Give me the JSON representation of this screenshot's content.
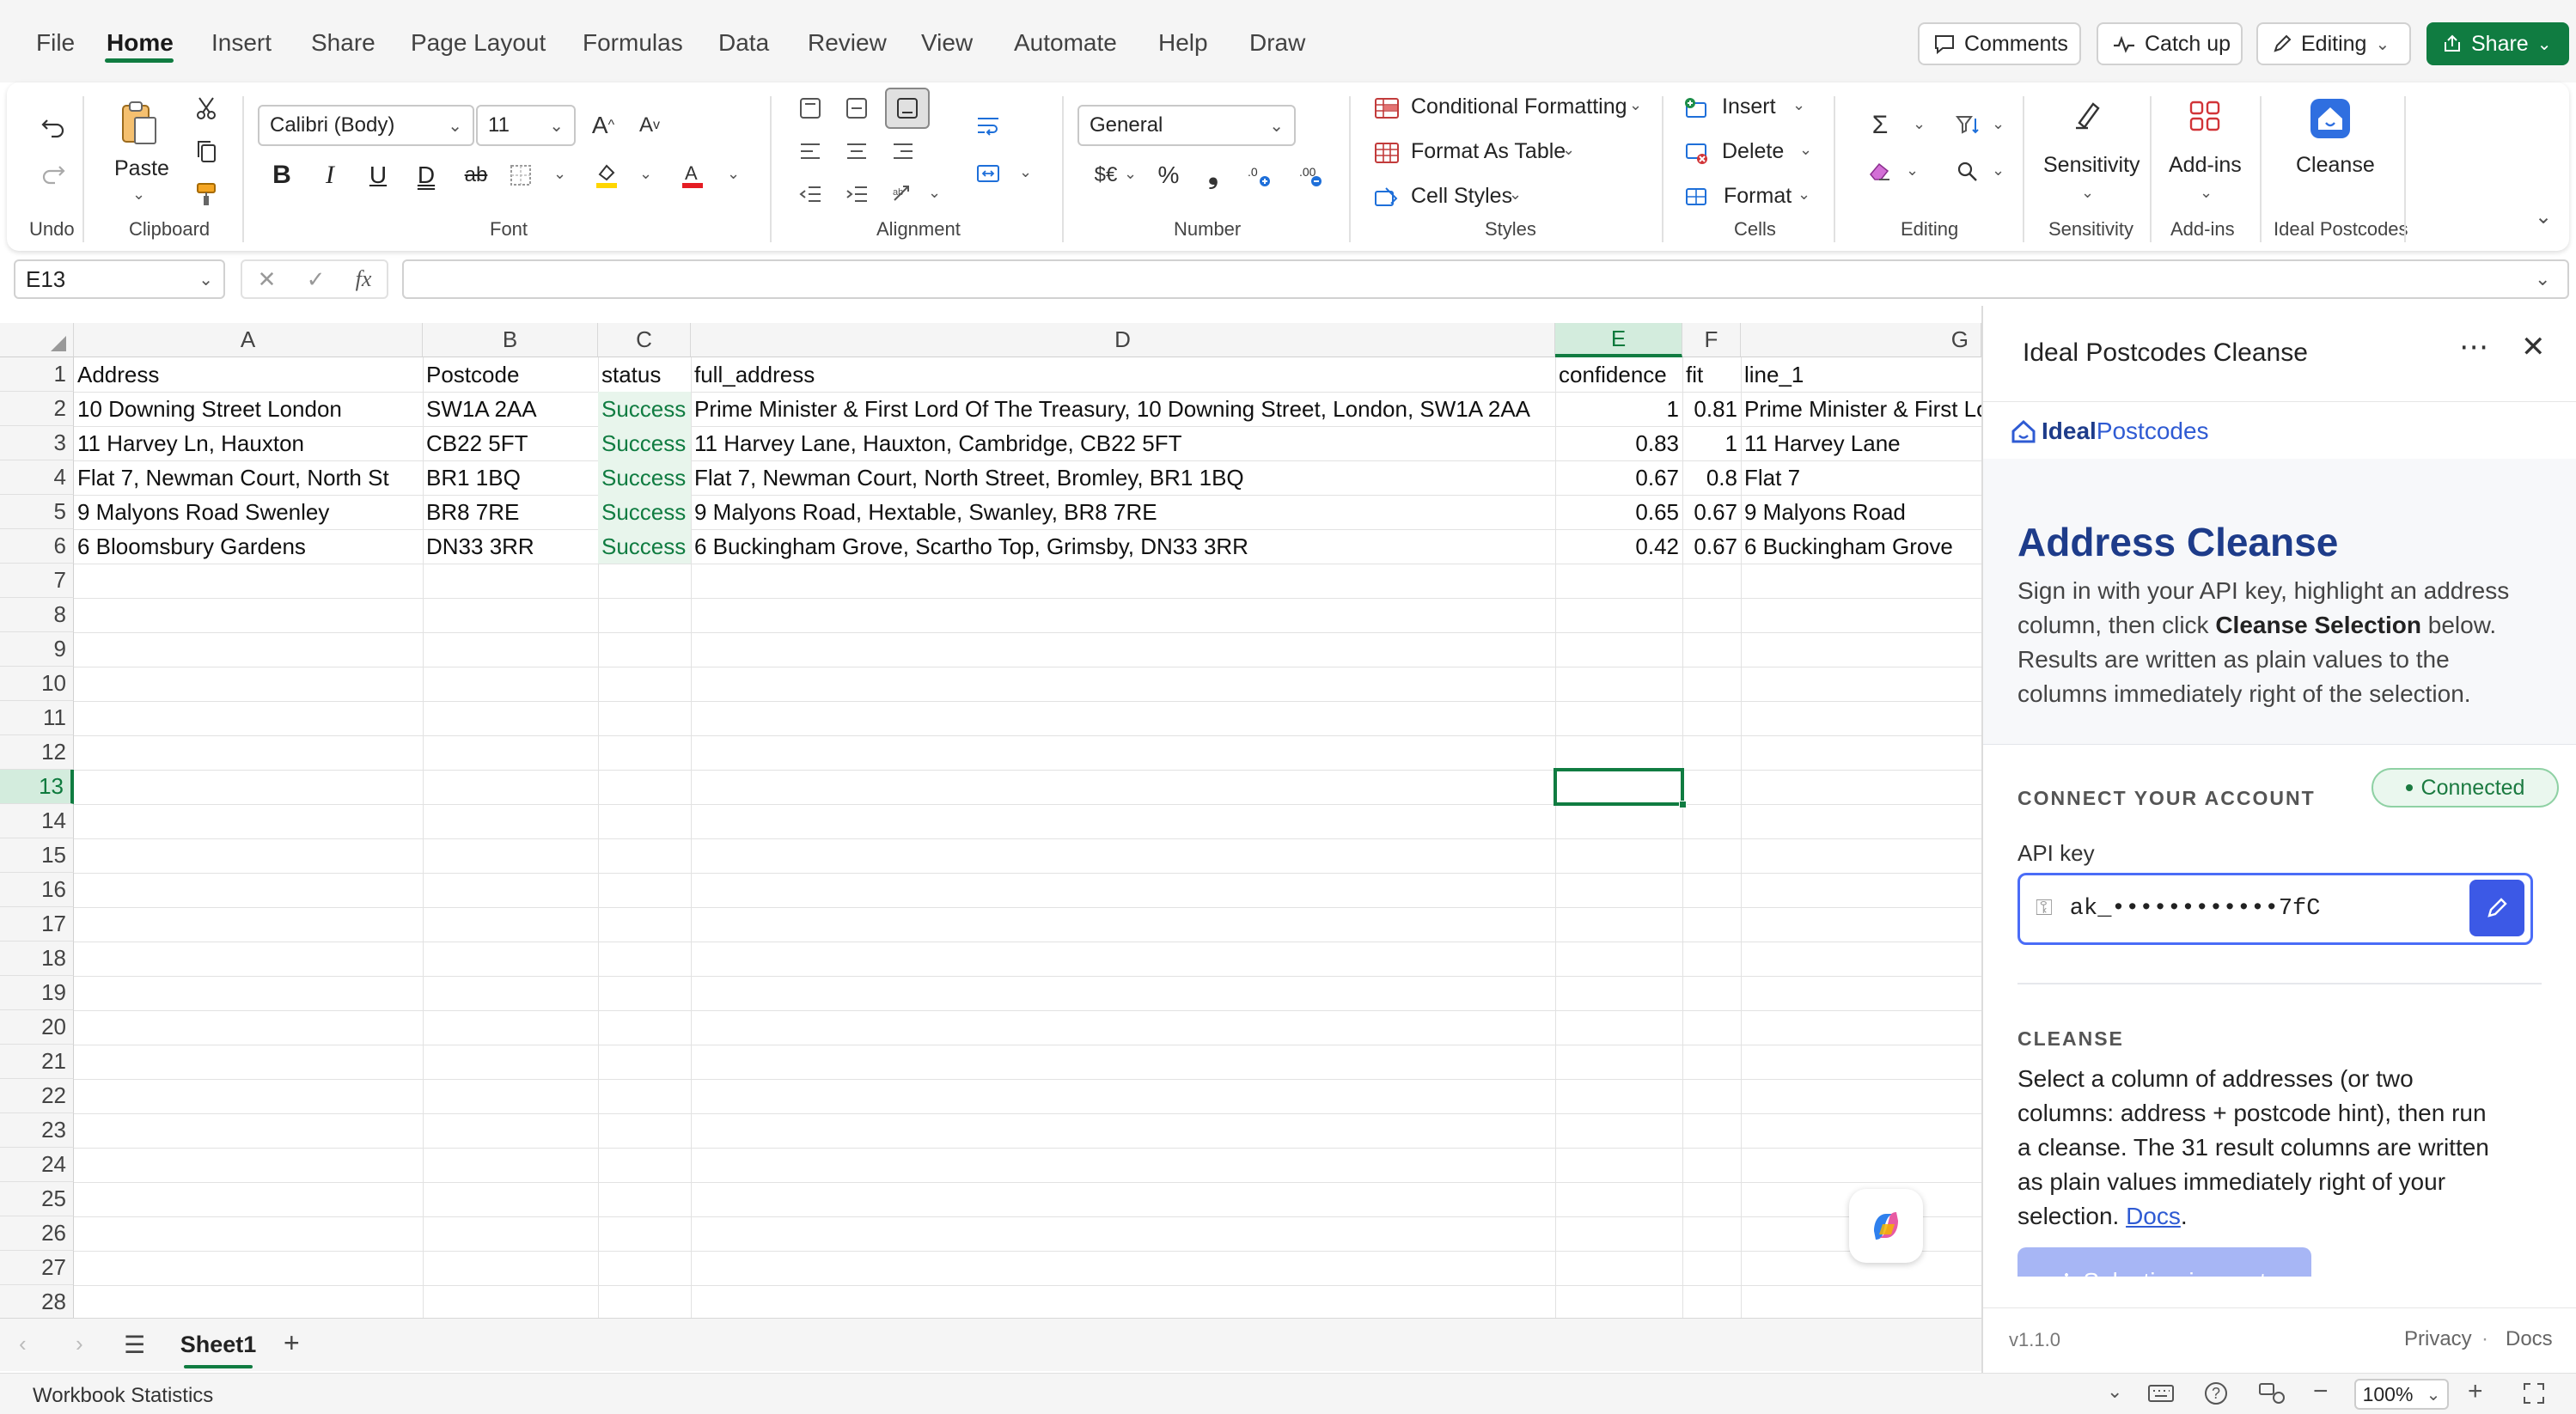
{
  "menu": {
    "items": [
      "File",
      "Home",
      "Insert",
      "Share",
      "Page Layout",
      "Formulas",
      "Data",
      "Review",
      "View",
      "Automate",
      "Help",
      "Draw"
    ],
    "active": "Home",
    "comments_label": "Comments",
    "catchup_label": "Catch up",
    "editing_label": "Editing",
    "share_label": "Share"
  },
  "ribbon": {
    "groups": {
      "undo": "Undo",
      "clipboard": "Clipboard",
      "font": "Font",
      "alignment": "Alignment",
      "number": "Number",
      "styles": "Styles",
      "cells": "Cells",
      "editing": "Editing",
      "sensitivity": "Sensitivity",
      "addins": "Add-ins",
      "ideal": "Ideal Postcodes"
    },
    "paste_label": "Paste",
    "font_name": "Calibri (Body)",
    "font_size": "11",
    "number_format": "General",
    "currency_symbol": "$€",
    "percent_symbol": "%",
    "comma_symbol": "❟",
    "conditional_formatting": "Conditional Formatting",
    "format_as_table": "Format As Table",
    "cell_styles": "Cell Styles",
    "insert": "Insert",
    "delete": "Delete",
    "format": "Format",
    "sensitivity_btn": "Sensitivity",
    "addins_btn": "Add-ins",
    "cleanse_btn": "Cleanse",
    "bold": "B",
    "italic": "I",
    "underline": "U",
    "dunderline": "D",
    "strike": "ab"
  },
  "formula_bar": {
    "name_box": "E13",
    "fx": "fx",
    "value": ""
  },
  "sheet": {
    "columns": [
      "A",
      "B",
      "C",
      "D",
      "E",
      "F",
      "G"
    ],
    "selected_column": "E",
    "row_numbers": [
      "1",
      "2",
      "3",
      "4",
      "5",
      "6",
      "7",
      "8",
      "9",
      "10",
      "11",
      "12",
      "13",
      "14",
      "15",
      "16",
      "17",
      "18",
      "19",
      "20",
      "21",
      "22",
      "23",
      "24",
      "25",
      "26",
      "27",
      "28"
    ],
    "selected_row": "13",
    "headers": [
      "Address",
      "Postcode",
      "status",
      "full_address",
      "confidence",
      "fit",
      "line_1"
    ],
    "rows": [
      [
        "10 Downing Street London",
        "SW1A 2AA",
        "Success",
        "Prime Minister & First Lord Of The Treasury, 10 Downing Street, London, SW1A 2AA",
        "1",
        "0.81",
        "Prime Minister & First Lord Of The Treasury"
      ],
      [
        "11 Harvey Ln, Hauxton",
        "CB22 5FT",
        "Success",
        "11 Harvey Lane, Hauxton, Cambridge, CB22 5FT",
        "0.83",
        "1",
        "11 Harvey Lane"
      ],
      [
        "Flat 7, Newman Court, North St",
        "BR1 1BQ",
        "Success",
        "Flat 7, Newman Court, North Street, Bromley, BR1 1BQ",
        "0.67",
        "0.8",
        "Flat 7"
      ],
      [
        "9 Malyons Road Swenley",
        "BR8 7RE",
        "Success",
        "9 Malyons Road, Hextable, Swanley, BR8 7RE",
        "0.65",
        "0.67",
        "9 Malyons Road"
      ],
      [
        "6 Bloomsbury Gardens",
        "DN33 3RR",
        "Success",
        "6 Buckingham Grove, Scartho Top, Grimsby, DN33 3RR",
        "0.42",
        "0.67",
        "6 Buckingham Grove"
      ]
    ]
  },
  "tabs": {
    "sheet_name": "Sheet1"
  },
  "status": {
    "left": "Workbook Statistics",
    "zoom": "100%"
  },
  "pane": {
    "title": "Ideal Postcodes Cleanse",
    "logo_bold": "Ideal",
    "logo_light": "Postcodes",
    "heading": "Address Cleanse",
    "intro_1": "Sign in with your API key, highlight an address",
    "intro_2a": "column, then click ",
    "intro_2b": "Cleanse Selection",
    "intro_2c": " below.",
    "intro_3": "Results are written as plain values to the",
    "intro_4": "columns immediately right of the selection.",
    "connect_title": "CONNECT YOUR ACCOUNT",
    "connected": "Connected",
    "api_label": "API key",
    "api_value": "ak_••••••••••••7fC",
    "cleanse_title": "CLEANSE",
    "cleanse_1": "Select a column of addresses (or two",
    "cleanse_2": "columns: address + postcode hint), then run",
    "cleanse_3": "a cleanse. The 31 result columns are written",
    "cleanse_4": "as plain values immediately right of your",
    "cleanse_5a": "selection. ",
    "cleanse_5b": "Docs",
    "cleanse_5c": ".",
    "button": "Selection is empty",
    "version": "v1.1.0",
    "privacy": "Privacy",
    "docs": "Docs",
    "sep": "·"
  },
  "colors": {
    "excel_green": "#107c41",
    "accent_blue": "#3c59e6",
    "success_bg": "#e8f5ec"
  }
}
